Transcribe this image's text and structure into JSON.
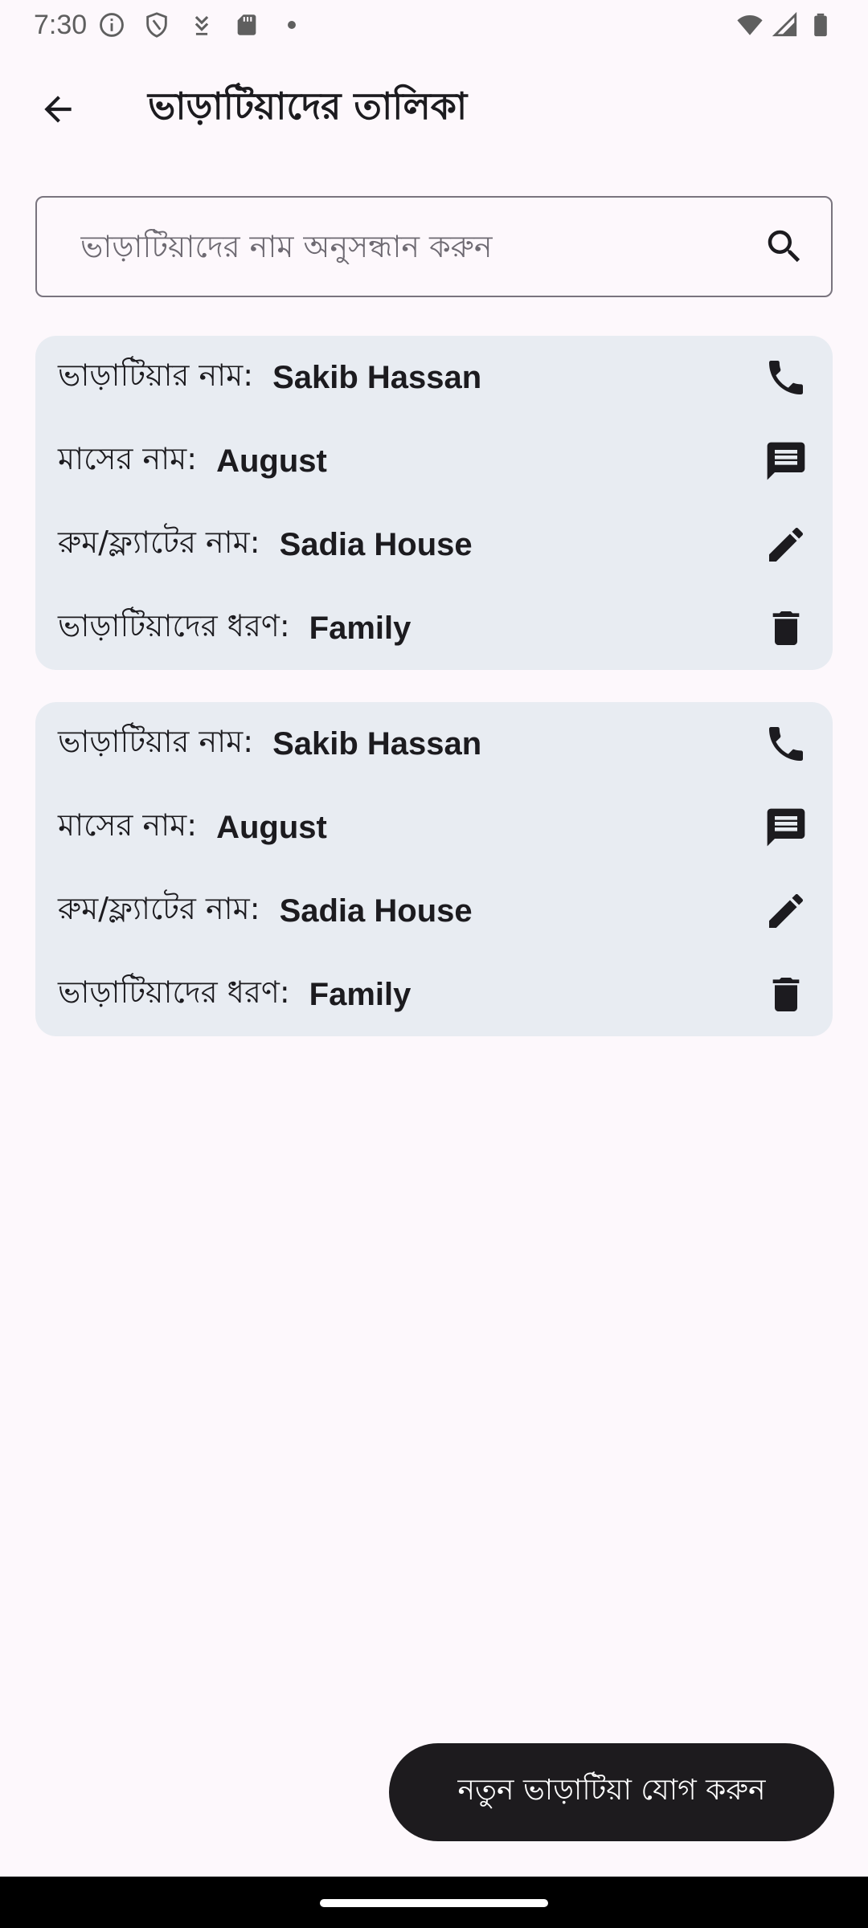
{
  "status_bar": {
    "time": "7:30",
    "icons": [
      "info-icon",
      "shield-icon",
      "download-icon",
      "sd-card-icon",
      "dot-icon",
      "wifi-icon",
      "signal-icon",
      "battery-icon"
    ]
  },
  "app_bar": {
    "title": "ভাড়াটিয়াদের তালিকা",
    "back_icon": "arrow-back-icon"
  },
  "search": {
    "placeholder": "ভাড়াটিয়াদের নাম অনুসন্ধান করুন",
    "value": "",
    "icon": "search-icon"
  },
  "tenants": [
    {
      "name_label": "ভাড়াটিয়ার নাম:",
      "name": "Sakib Hassan",
      "month_label": "মাসের নাম:",
      "month": "August",
      "room_label": "রুম/ফ্ল্যাটের নাম:",
      "room": "Sadia House",
      "type_label": "ভাড়াটিয়াদের ধরণ:",
      "type": "Family"
    },
    {
      "name_label": "ভাড়াটিয়ার নাম:",
      "name": "Sakib Hassan",
      "month_label": "মাসের নাম:",
      "month": "August",
      "room_label": "রুম/ফ্ল্যাটের নাম:",
      "room": "Sadia House",
      "type_label": "ভাড়াটিয়াদের ধরণ:",
      "type": "Family"
    }
  ],
  "actions": {
    "call_icon": "phone-icon",
    "message_icon": "message-icon",
    "edit_icon": "edit-icon",
    "delete_icon": "delete-icon"
  },
  "fab": {
    "label": "নতুন ভাড়াটিয়া যোগ করুন"
  },
  "colors": {
    "background": "#fdf8fc",
    "card": "#e8ecf2",
    "fab": "#1d1b1e",
    "text": "#1c1b1f"
  }
}
